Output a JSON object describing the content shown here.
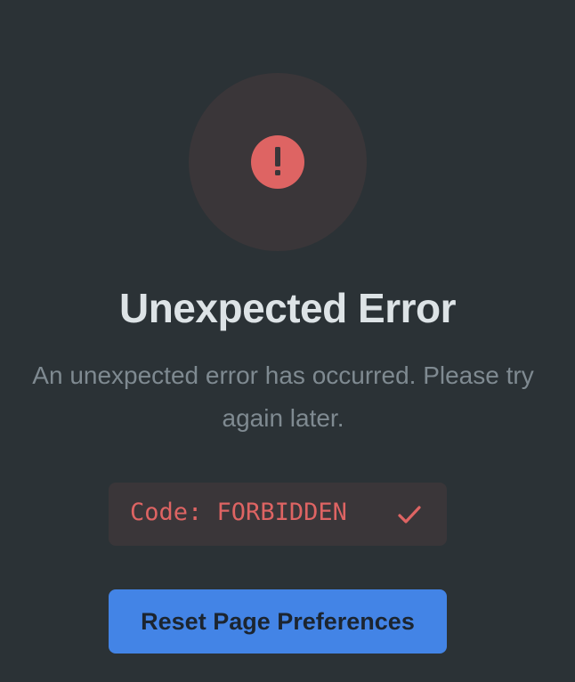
{
  "error": {
    "icon": "alert-circle-icon",
    "title": "Unexpected Error",
    "message": "An unexpected error has occurred. Please try again later.",
    "code_label": "Code:",
    "code_value": "FORBIDDEN",
    "copy_icon": "check-icon"
  },
  "actions": {
    "reset_label": "Reset Page Preferences"
  },
  "colors": {
    "background": "#2b3236",
    "icon_circle": "#3a3639",
    "error_red": "#de6463",
    "title_text": "#dde3e6",
    "message_text": "#7f8a91",
    "button": "#4384e6"
  }
}
